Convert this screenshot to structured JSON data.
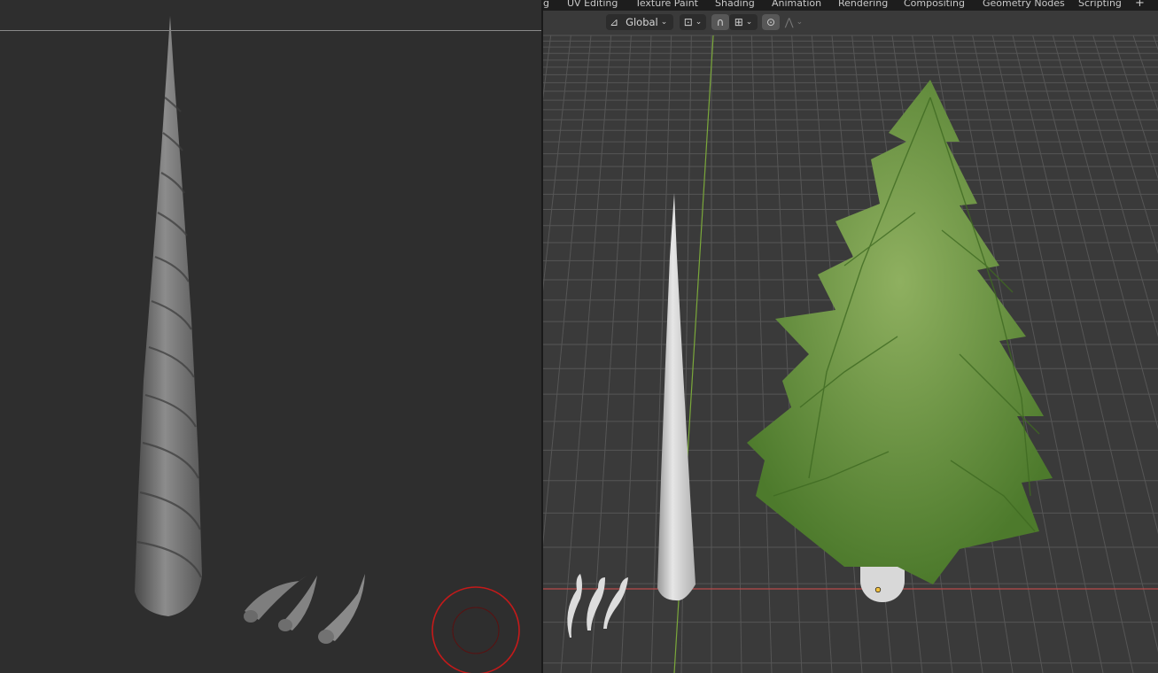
{
  "workspace_tabs": [
    {
      "label": "g"
    },
    {
      "label": "UV Editing"
    },
    {
      "label": "Texture Paint"
    },
    {
      "label": "Shading"
    },
    {
      "label": "Animation"
    },
    {
      "label": "Rendering"
    },
    {
      "label": "Compositing"
    },
    {
      "label": "Geometry Nodes"
    },
    {
      "label": "Scripting"
    }
  ],
  "add_tab_label": "+",
  "toolbar": {
    "transform_orientation": "Global"
  },
  "icons": {
    "orientation": "transform-orientation-icon",
    "pivot": "pivot-point-icon",
    "snap": "snap-magnet-icon",
    "snap_target": "snap-increment-icon",
    "proportional": "proportional-edit-icon",
    "falloff": "falloff-curve-icon"
  },
  "colors": {
    "grid_line": "#565656",
    "x_axis": "#b84a4a",
    "y_axis": "#7aa83a",
    "tree_green": "#5f8f3a",
    "brush_cursor": "#c41a1a"
  }
}
